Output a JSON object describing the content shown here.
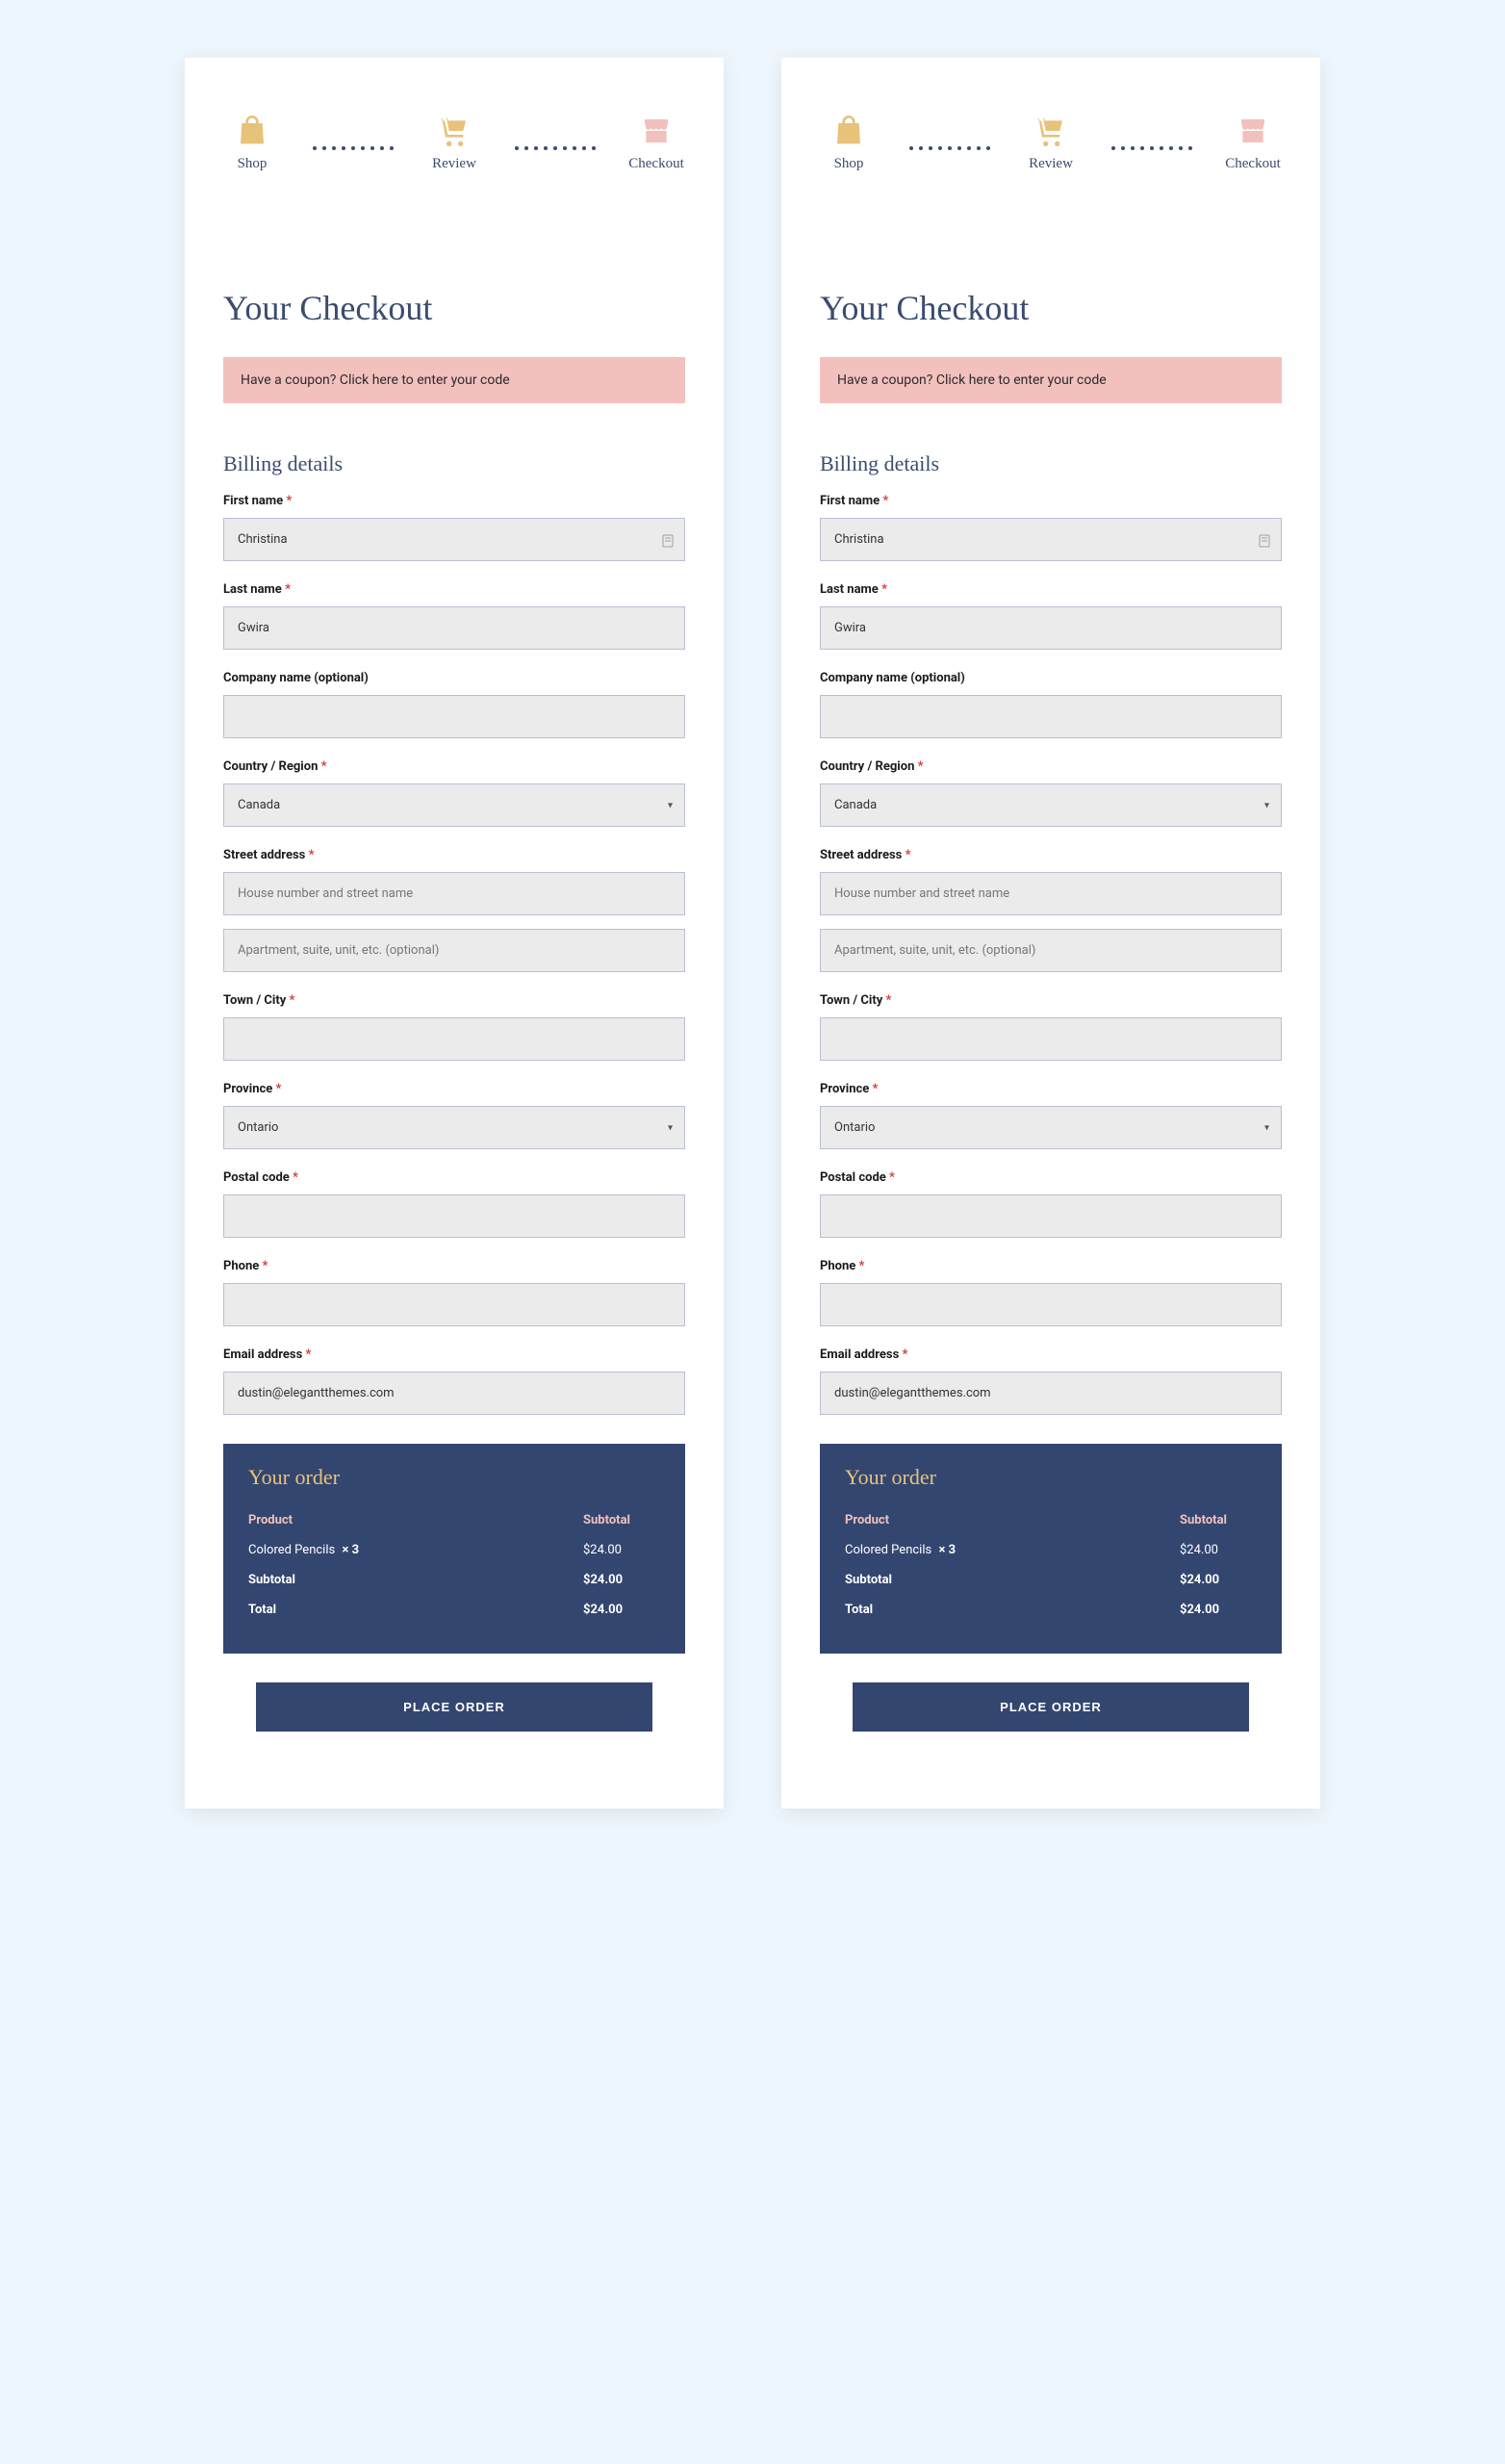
{
  "stepper": {
    "shop": {
      "label": "Shop"
    },
    "review": {
      "label": "Review"
    },
    "checkout": {
      "label": "Checkout"
    }
  },
  "page_title": "Your Checkout",
  "coupon_text": "Have a coupon? Click here to enter your code",
  "billing_heading": "Billing details",
  "fields": {
    "first_name": {
      "label": "First name",
      "required": "*",
      "value": "Christina"
    },
    "last_name": {
      "label": "Last name",
      "required": "*",
      "value": "Gwira"
    },
    "company": {
      "label": "Company name (optional)",
      "value": ""
    },
    "country": {
      "label": "Country / Region",
      "required": "*",
      "value": "Canada"
    },
    "street": {
      "label": "Street address",
      "required": "*",
      "placeholder1": "House number and street name",
      "placeholder2": "Apartment, suite, unit, etc. (optional)"
    },
    "city": {
      "label": "Town / City",
      "required": "*",
      "value": ""
    },
    "province": {
      "label": "Province",
      "required": "*",
      "value": "Ontario"
    },
    "postal": {
      "label": "Postal code",
      "required": "*",
      "value": ""
    },
    "phone": {
      "label": "Phone",
      "required": "*",
      "value": ""
    },
    "email": {
      "label": "Email address",
      "required": "*",
      "value": "dustin@elegantthemes.com"
    }
  },
  "order": {
    "title": "Your order",
    "head_product": "Product",
    "head_subtotal": "Subtotal",
    "item_name": "Colored Pencils",
    "item_qty": "× 3",
    "item_price": "$24.00",
    "subtotal_label": "Subtotal",
    "subtotal_value": "$24.00",
    "total_label": "Total",
    "total_value": "$24.00"
  },
  "button_label": "PLACE ORDER"
}
